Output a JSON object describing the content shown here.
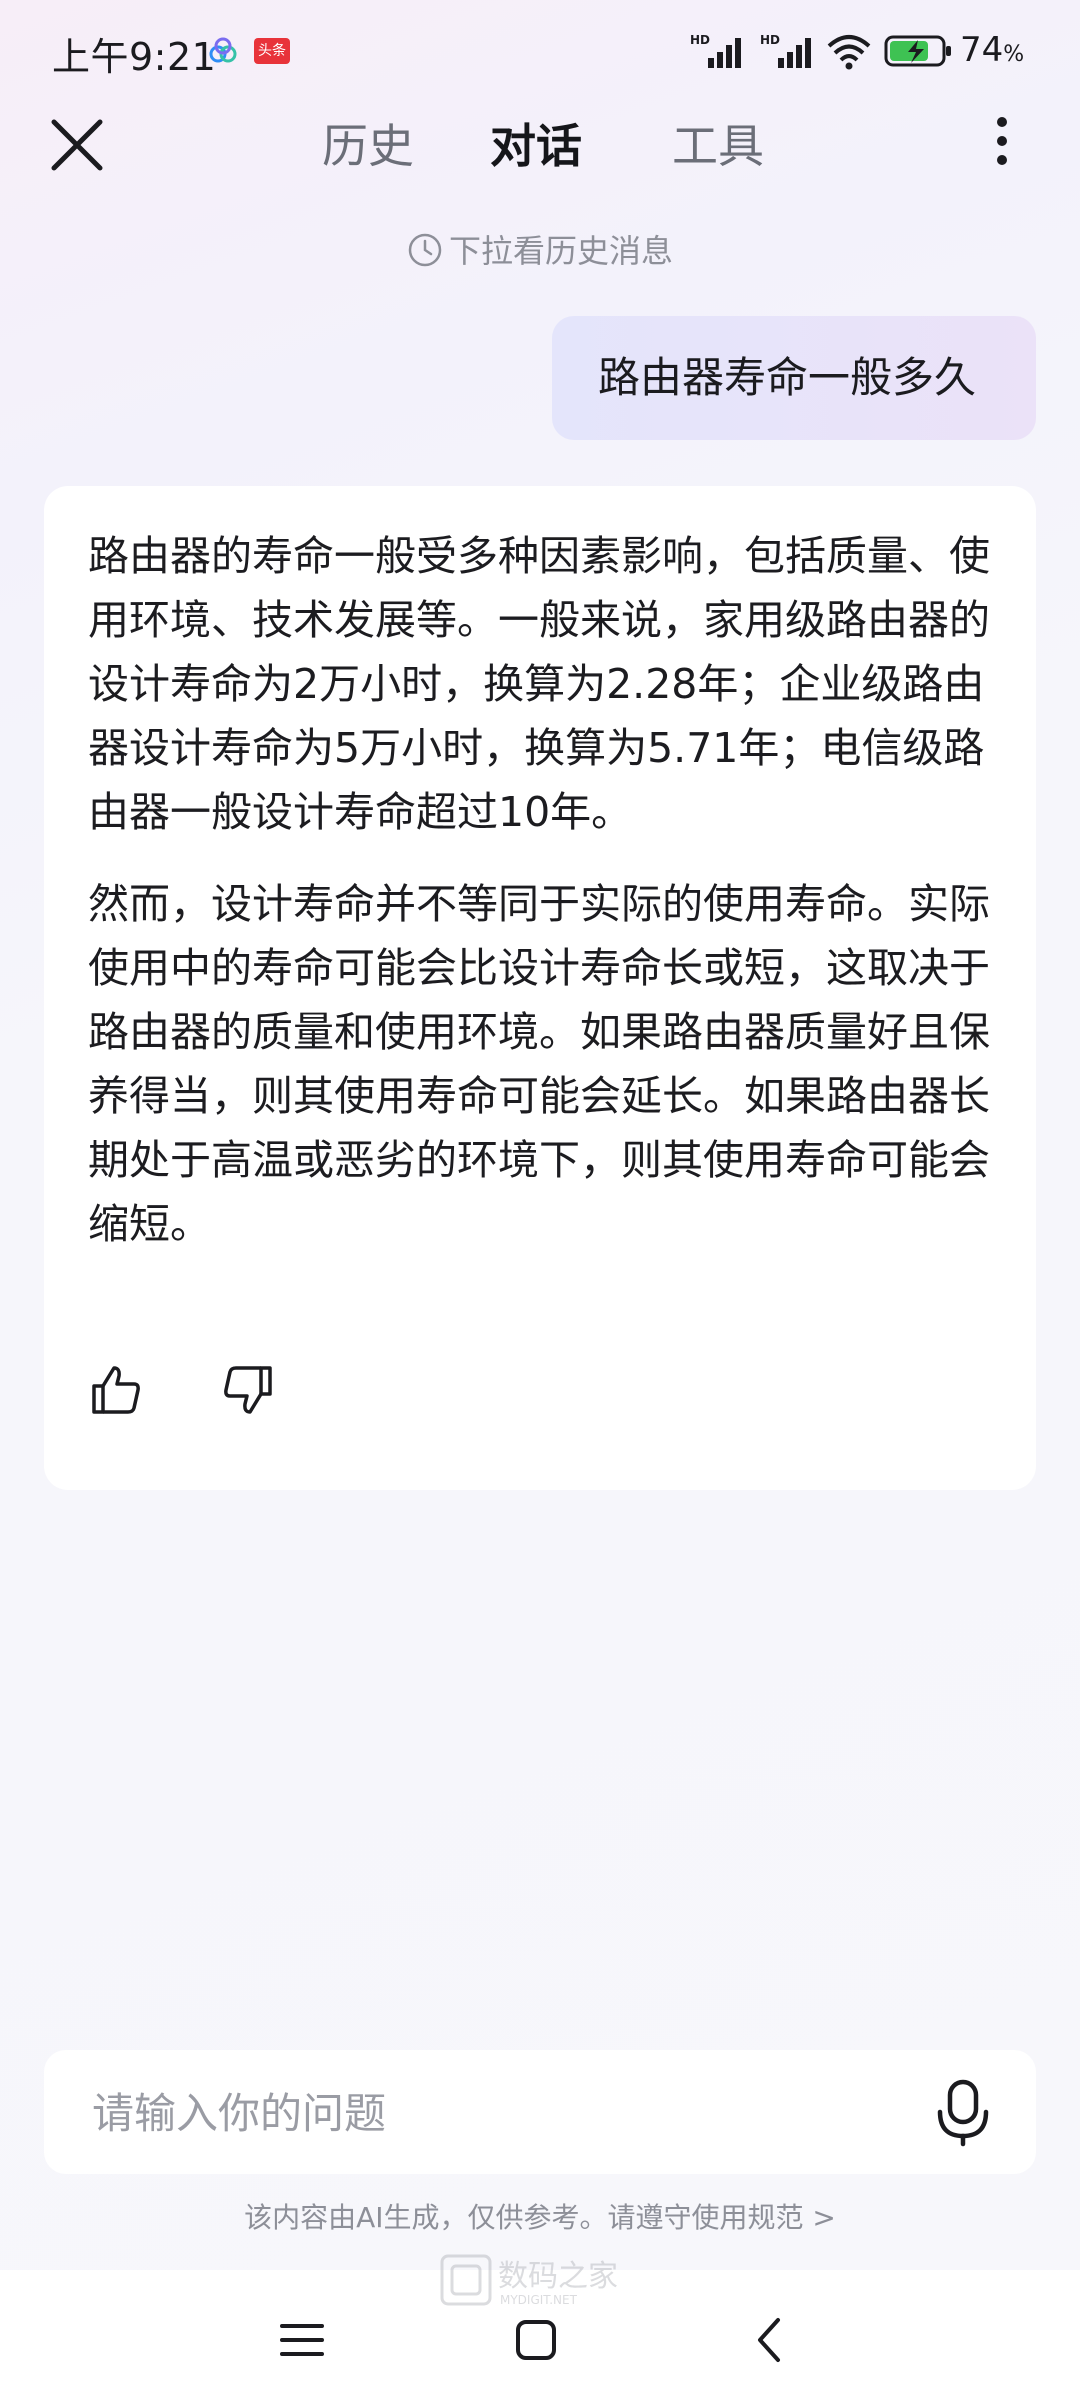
{
  "status_bar": {
    "time": "上午9:21",
    "app_badge": "头条",
    "battery_level": "74",
    "battery_unit": "%"
  },
  "header": {
    "tabs": [
      {
        "label": "历史",
        "active": false
      },
      {
        "label": "对话",
        "active": true
      },
      {
        "label": "工具",
        "active": false
      }
    ]
  },
  "chat": {
    "history_hint": "下拉看历史消息",
    "user_message": "路由器寿命一般多久",
    "answer_paragraphs": [
      "路由器的寿命一般受多种因素影响，包括质量、使用环境、技术发展等。一般来说，家用级路由器的设计寿命为2万小时，换算为2.28年；企业级路由器设计寿命为5万小时，换算为5.71年；电信级路由器一般设计寿命超过10年。",
      "然而，设计寿命并不等同于实际的使用寿命。实际使用中的寿命可能会比设计寿命长或短，这取决于路由器的质量和使用环境。如果路由器质量好且保养得当，则其使用寿命可能会延长。如果路由器长期处于高温或恶劣的环境下，则其使用寿命可能会缩短。"
    ]
  },
  "input": {
    "placeholder": "请输入你的问题"
  },
  "disclaimer": "该内容由AI生成，仅供参考。请遵守使用规范 >",
  "watermark": {
    "text": "数码之家",
    "subtext": "MYDIGIT.NET"
  },
  "colors": {
    "user_bubble_start": "#e4e5fb",
    "user_bubble_end": "#ebe2f8",
    "card_bg": "#ffffff",
    "muted_text": "#8d8f98"
  }
}
